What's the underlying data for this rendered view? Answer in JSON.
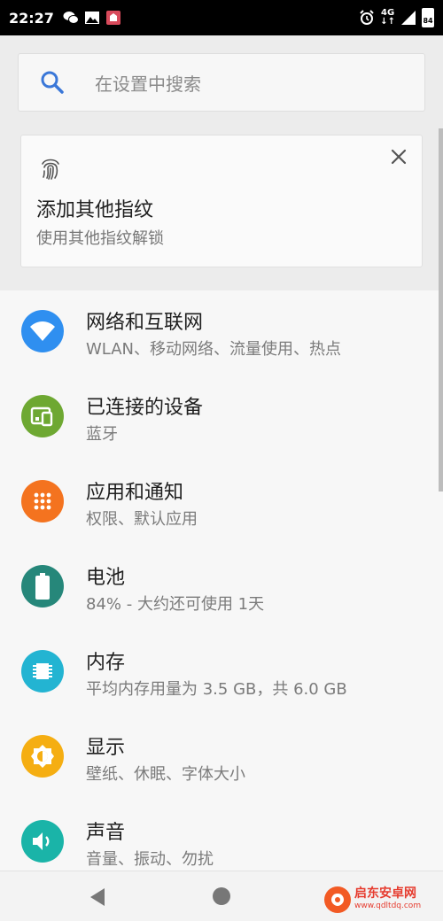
{
  "statusbar": {
    "time": "22:27",
    "net": "4G",
    "battery": "84"
  },
  "search": {
    "placeholder": "在设置中搜索"
  },
  "suggestion": {
    "title": "添加其他指纹",
    "subtitle": "使用其他指纹解锁"
  },
  "items": [
    {
      "title": "网络和互联网",
      "subtitle": "WLAN、移动网络、流量使用、热点",
      "color": "#2f8ff0",
      "icon": "wifi-icon"
    },
    {
      "title": "已连接的设备",
      "subtitle": "蓝牙",
      "color": "#6ea832",
      "icon": "devices-icon"
    },
    {
      "title": "应用和通知",
      "subtitle": "权限、默认应用",
      "color": "#f4731f",
      "icon": "apps-icon"
    },
    {
      "title": "电池",
      "subtitle": "84% - 大约还可使用 1天",
      "color": "#26877a",
      "icon": "battery-icon"
    },
    {
      "title": "内存",
      "subtitle": "平均内存用量为 3.5 GB，共 6.0 GB",
      "color": "#23b4d2",
      "icon": "memory-icon"
    },
    {
      "title": "显示",
      "subtitle": "壁纸、休眠、字体大小",
      "color": "#f5ae12",
      "icon": "brightness-icon"
    },
    {
      "title": "声音",
      "subtitle": "音量、振动、勿扰",
      "color": "#1ab4a8",
      "icon": "volume-icon"
    }
  ],
  "watermark": {
    "name": "启东安卓网",
    "url": "www.qdltdq.com"
  }
}
